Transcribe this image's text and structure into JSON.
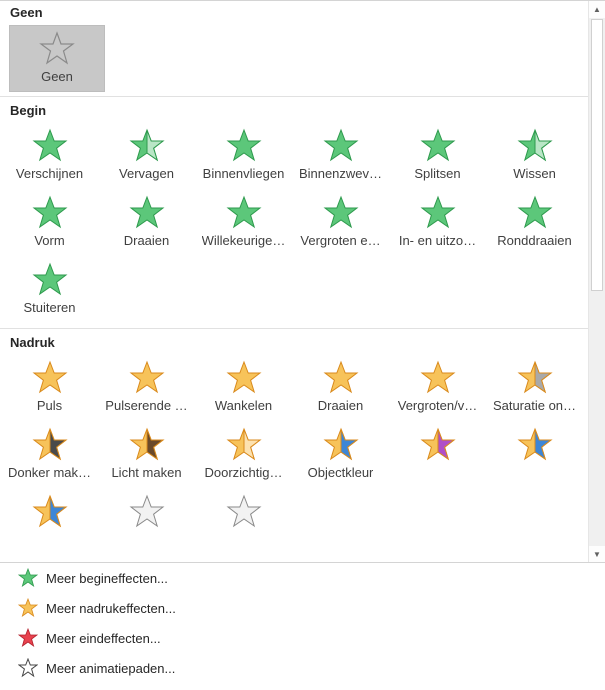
{
  "sections": [
    {
      "title": "Geen",
      "items": [
        {
          "label": "Geen",
          "icon": "none-star-icon",
          "selected": true
        }
      ]
    },
    {
      "title": "Begin",
      "items": [
        {
          "label": "Verschijnen",
          "icon": "appear-star-icon"
        },
        {
          "label": "Vervagen",
          "icon": "fade-star-icon"
        },
        {
          "label": "Binnenvliegen",
          "icon": "fly-in-star-icon"
        },
        {
          "label": "Binnenzwev…",
          "icon": "float-in-star-icon"
        },
        {
          "label": "Splitsen",
          "icon": "split-star-icon"
        },
        {
          "label": "Wissen",
          "icon": "wipe-star-icon"
        },
        {
          "label": "Vorm",
          "icon": "shape-star-icon"
        },
        {
          "label": "Draaien",
          "icon": "wheel-star-icon"
        },
        {
          "label": "Willekeurige…",
          "icon": "random-bars-star-icon"
        },
        {
          "label": "Vergroten e…",
          "icon": "grow-turn-star-icon"
        },
        {
          "label": "In- en uitzo…",
          "icon": "zoom-star-icon"
        },
        {
          "label": "Ronddraaien",
          "icon": "swivel-star-icon"
        },
        {
          "label": "Stuiteren",
          "icon": "bounce-star-icon"
        }
      ]
    },
    {
      "title": "Nadruk",
      "items": [
        {
          "label": "Puls",
          "icon": "pulse-star-icon"
        },
        {
          "label": "Pulserende …",
          "icon": "color-pulse-star-icon"
        },
        {
          "label": "Wankelen",
          "icon": "teeter-star-icon"
        },
        {
          "label": "Draaien",
          "icon": "spin-star-icon"
        },
        {
          "label": "Vergroten/v…",
          "icon": "grow-shrink-star-icon"
        },
        {
          "label": "Saturatie on…",
          "icon": "desaturate-star-icon"
        },
        {
          "label": "Donker mak…",
          "icon": "darken-star-icon"
        },
        {
          "label": "Licht maken",
          "icon": "lighten-star-icon"
        },
        {
          "label": "Doorzichtig…",
          "icon": "transparency-star-icon"
        },
        {
          "label": "Objectkleur",
          "icon": "object-color-star-icon"
        },
        {
          "label": "",
          "icon": "complementary-color-star-icon"
        },
        {
          "label": "",
          "icon": "line-color-star-icon"
        },
        {
          "label": "",
          "icon": "fill-color-star-icon"
        },
        {
          "label": "",
          "icon": "brush-color-star-icon"
        },
        {
          "label": "",
          "icon": "font-color-star-icon"
        }
      ]
    }
  ],
  "menu": [
    {
      "label": "Meer begineffecten...",
      "icon": "entrance-effects-icon"
    },
    {
      "label": "Meer nadrukeffecten...",
      "icon": "emphasis-effects-icon"
    },
    {
      "label": "Meer eindeffecten...",
      "icon": "exit-effects-icon"
    },
    {
      "label": "Meer animatiepaden...",
      "icon": "motion-paths-icon"
    }
  ],
  "colors": {
    "green_fill": "#5cc77a",
    "green_stroke": "#2e9a4d",
    "gold_fill": "#f7c35a",
    "gold_stroke": "#d98a1c",
    "red_fill": "#e8434f",
    "gray_stroke": "#8a8a8a"
  }
}
